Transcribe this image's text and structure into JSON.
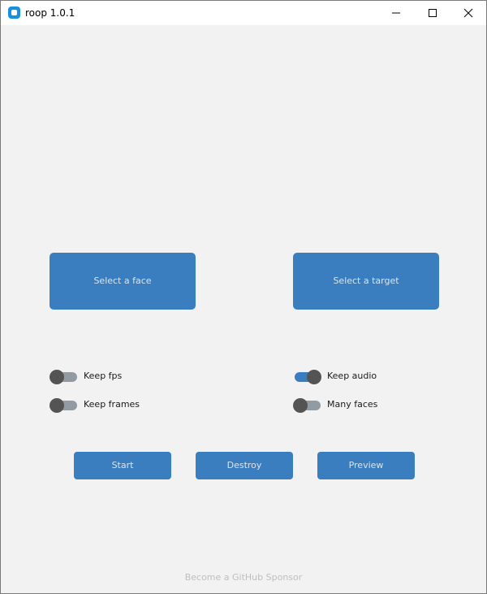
{
  "window": {
    "title": "roop 1.0.1"
  },
  "main": {
    "select_face_label": "Select a face",
    "select_target_label": "Select a target",
    "switches": {
      "keep_fps": {
        "label": "Keep fps",
        "on": false
      },
      "keep_frames": {
        "label": "Keep frames",
        "on": false
      },
      "keep_audio": {
        "label": "Keep audio",
        "on": true
      },
      "many_faces": {
        "label": "Many faces",
        "on": false
      }
    },
    "start_label": "Start",
    "destroy_label": "Destroy",
    "preview_label": "Preview",
    "sponsor_link": "Become a GitHub Sponsor"
  },
  "colors": {
    "accent": "#3a7ebf",
    "background": "#f2f2f2",
    "button_text": "#dce4ee",
    "switch_off_track": "#939ba2",
    "switch_knob": "#545454"
  },
  "icons": {
    "app": "roop-app-icon",
    "minimize": "minimize-icon",
    "maximize": "maximize-icon",
    "close": "close-icon"
  }
}
